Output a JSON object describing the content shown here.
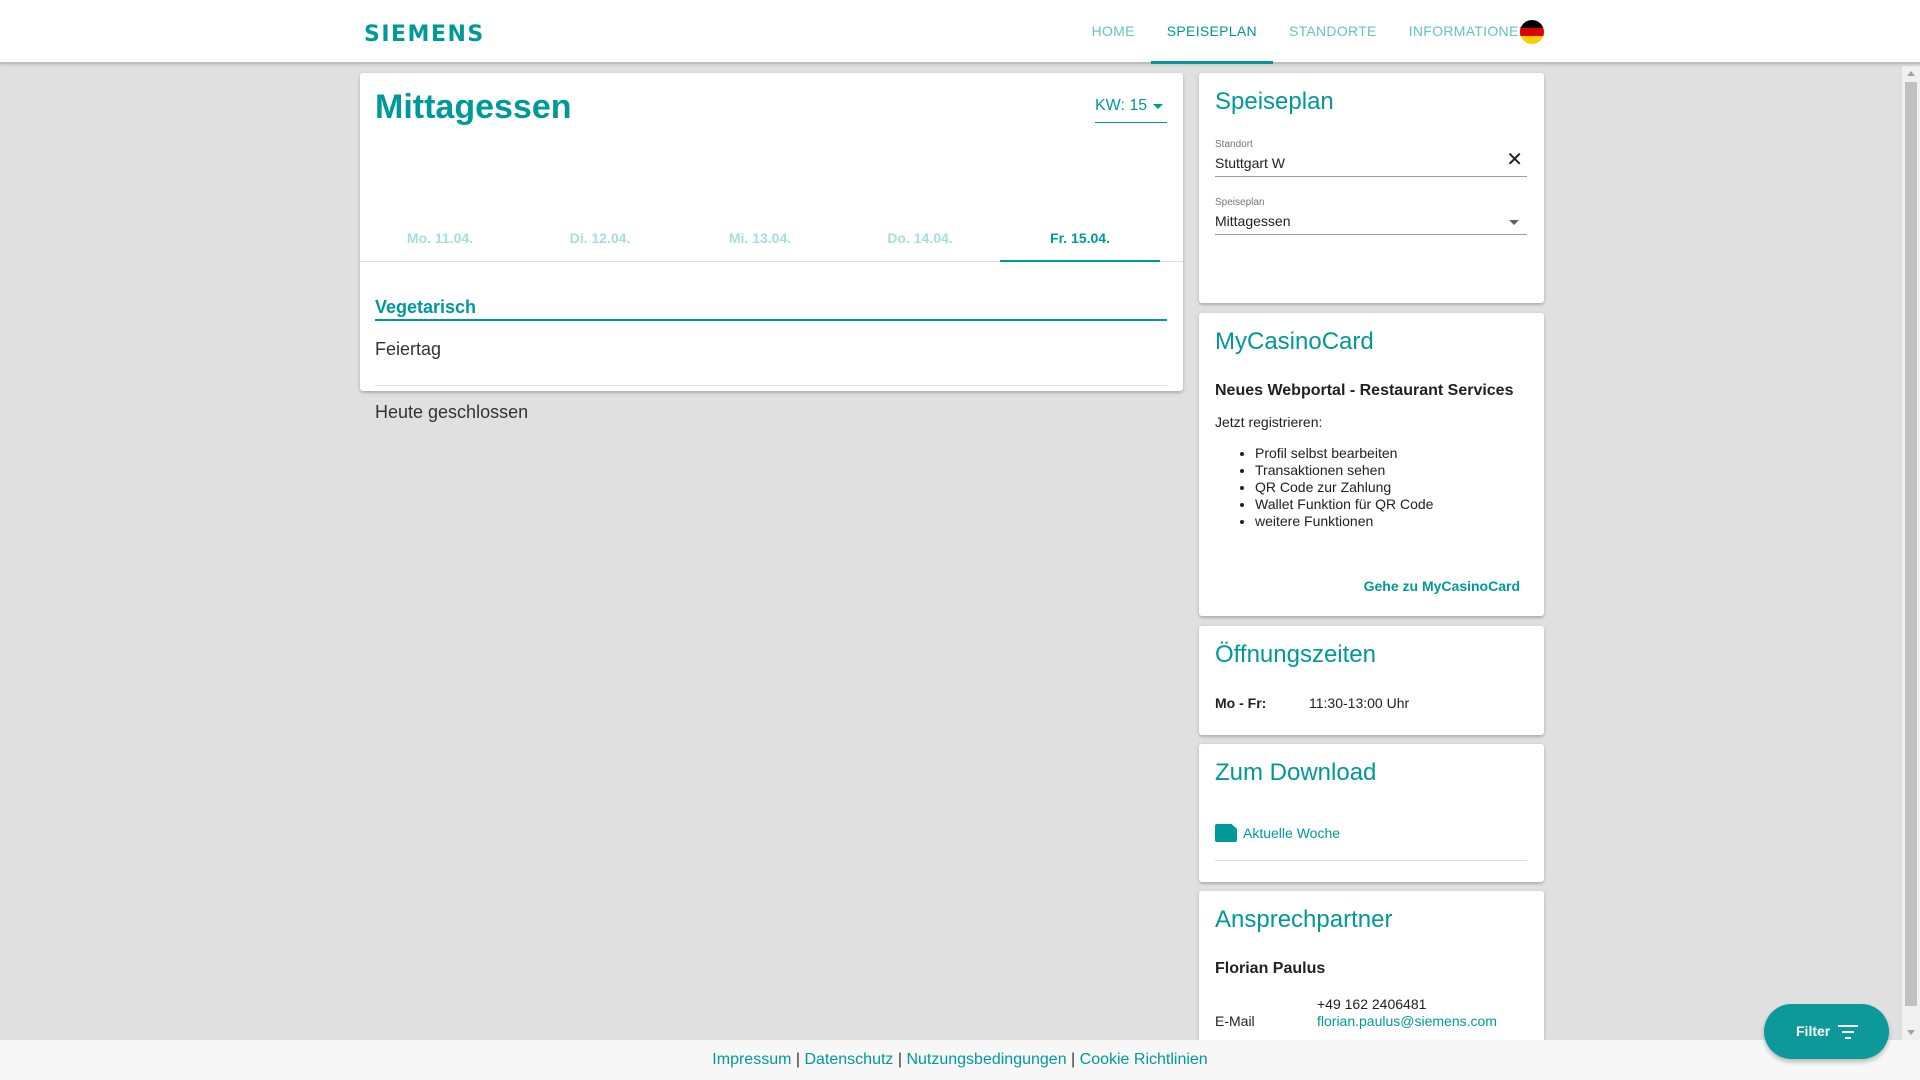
{
  "header": {
    "logo": "SIEMENS",
    "nav": [
      "HOME",
      "SPEISEPLAN",
      "STANDORTE",
      "INFORMATIONEN"
    ],
    "active_nav": "SPEISEPLAN",
    "language_flag_icon": "germany-flag-icon"
  },
  "main": {
    "title": "Mittagessen",
    "week_select": "KW: 15",
    "days": [
      "Mo. 11.04.",
      "Di. 12.04.",
      "Mi. 13.04.",
      "Do. 14.04.",
      "Fr. 15.04."
    ],
    "active_day": "Fr. 15.04.",
    "category": "Vegetarisch",
    "meals": [
      "Feiertag",
      "Heute geschlossen"
    ]
  },
  "sidebar": {
    "speiseplan": {
      "title": "Speiseplan",
      "standort_label": "Standort",
      "standort_value": "Stuttgart W",
      "speiseplan_label": "Speiseplan",
      "speiseplan_value": "Mittagessen"
    },
    "mycasinocard": {
      "title": "MyCasinoCard",
      "subtitle": "Neues Webportal - Restaurant Services",
      "intro": "Jetzt registrieren:",
      "items": [
        "Profil selbst bearbeiten",
        "Transaktionen sehen",
        "QR Code zur Zahlung",
        "Wallet Funktion für QR Code",
        "weitere Funktionen"
      ],
      "link": "Gehe zu MyCasinoCard"
    },
    "hours": {
      "title": "Öffnungszeiten",
      "day": "Mo - Fr:",
      "time": "11:30-13:00 Uhr"
    },
    "download": {
      "title": "Zum Download",
      "link": "Aktuelle Woche",
      "icon": "file-icon"
    },
    "contact": {
      "title": "Ansprechpartner",
      "name": "Florian Paulus",
      "phone": "+49 162 2406481",
      "email_label": "E-Mail",
      "email": "florian.paulus@siemens.com"
    }
  },
  "footer": {
    "links": [
      "Impressum",
      "Datenschutz",
      "Nutzungsbedingungen",
      "Cookie Richtlinien"
    ],
    "separator": " | "
  },
  "fab": {
    "label": "Filter",
    "icon": "filter-list-icon"
  },
  "colors": {
    "accent": "#009999",
    "background": "#e0e0e0"
  }
}
